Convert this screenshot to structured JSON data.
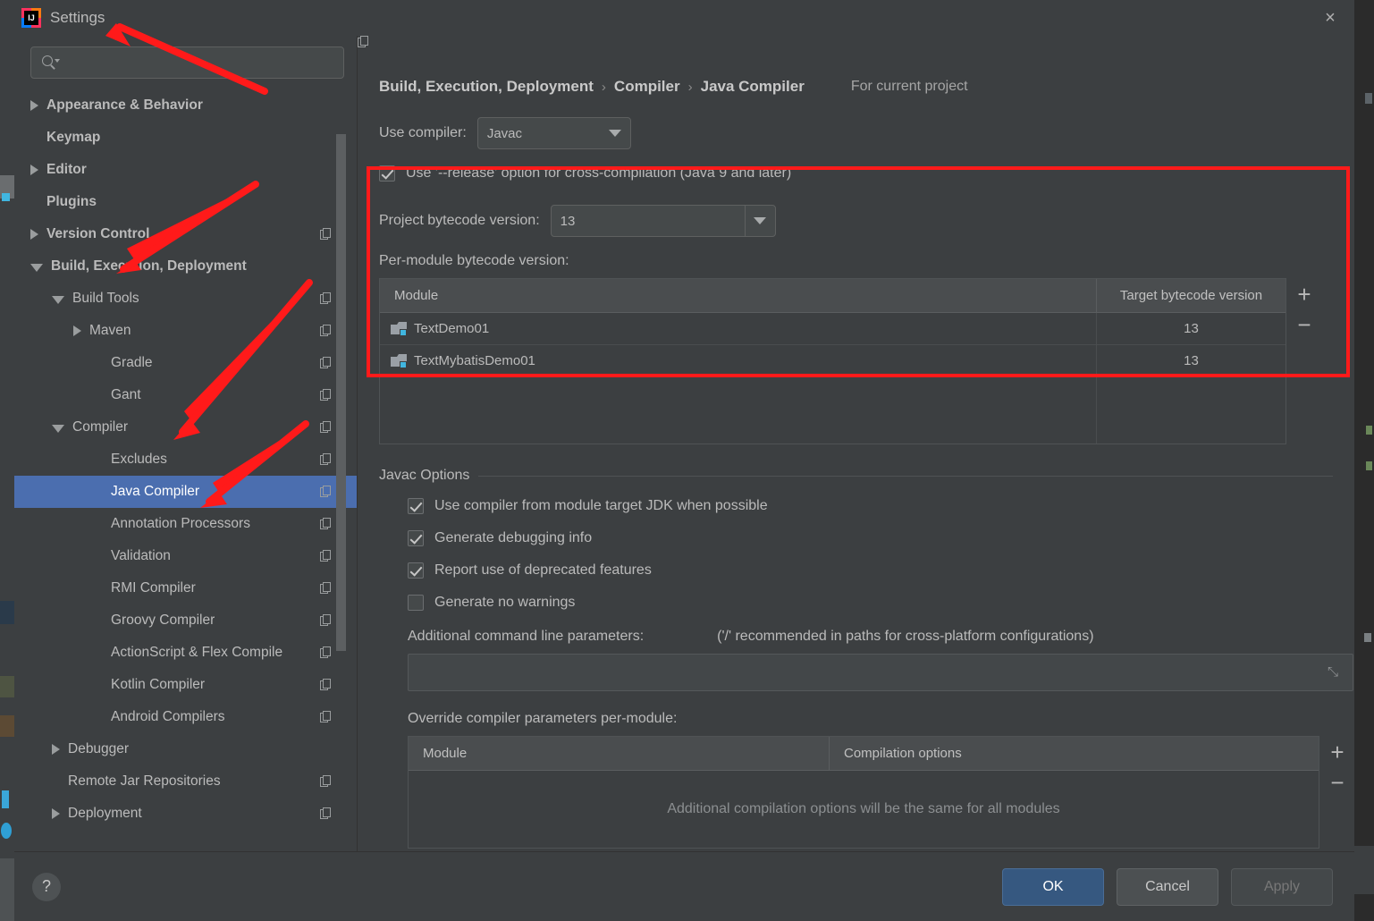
{
  "window": {
    "title": "Settings",
    "logo_text": "IJ",
    "close_label": "×"
  },
  "search": {
    "value": "",
    "placeholder": ""
  },
  "sidebar": {
    "items": [
      {
        "label": "Appearance & Behavior",
        "indent": 0,
        "state": "collapsed",
        "bold": true,
        "copy": false,
        "selected": false
      },
      {
        "label": "Keymap",
        "indent": 0,
        "state": "leaf",
        "bold": true,
        "copy": false,
        "selected": false
      },
      {
        "label": "Editor",
        "indent": 0,
        "state": "collapsed",
        "bold": true,
        "copy": false,
        "selected": false
      },
      {
        "label": "Plugins",
        "indent": 0,
        "state": "leaf",
        "bold": true,
        "copy": false,
        "selected": false
      },
      {
        "label": "Version Control",
        "indent": 0,
        "state": "collapsed",
        "bold": true,
        "copy": true,
        "selected": false
      },
      {
        "label": "Build, Execution, Deployment",
        "indent": 0,
        "state": "expanded",
        "bold": true,
        "copy": false,
        "selected": false
      },
      {
        "label": "Build Tools",
        "indent": 1,
        "state": "expanded",
        "bold": false,
        "copy": true,
        "selected": false
      },
      {
        "label": "Maven",
        "indent": 2,
        "state": "collapsed",
        "bold": false,
        "copy": true,
        "selected": false
      },
      {
        "label": "Gradle",
        "indent": 3,
        "state": "leaf",
        "bold": false,
        "copy": true,
        "selected": false
      },
      {
        "label": "Gant",
        "indent": 3,
        "state": "leaf",
        "bold": false,
        "copy": true,
        "selected": false
      },
      {
        "label": "Compiler",
        "indent": 1,
        "state": "expanded",
        "bold": false,
        "copy": true,
        "selected": false
      },
      {
        "label": "Excludes",
        "indent": 3,
        "state": "leaf",
        "bold": false,
        "copy": true,
        "selected": false
      },
      {
        "label": "Java Compiler",
        "indent": 3,
        "state": "leaf",
        "bold": false,
        "copy": true,
        "selected": true
      },
      {
        "label": "Annotation Processors",
        "indent": 3,
        "state": "leaf",
        "bold": false,
        "copy": true,
        "selected": false
      },
      {
        "label": "Validation",
        "indent": 3,
        "state": "leaf",
        "bold": false,
        "copy": true,
        "selected": false
      },
      {
        "label": "RMI Compiler",
        "indent": 3,
        "state": "leaf",
        "bold": false,
        "copy": true,
        "selected": false
      },
      {
        "label": "Groovy Compiler",
        "indent": 3,
        "state": "leaf",
        "bold": false,
        "copy": true,
        "selected": false
      },
      {
        "label": "ActionScript & Flex Compile",
        "indent": 3,
        "state": "leaf",
        "bold": false,
        "copy": true,
        "selected": false
      },
      {
        "label": "Kotlin Compiler",
        "indent": 3,
        "state": "leaf",
        "bold": false,
        "copy": true,
        "selected": false
      },
      {
        "label": "Android Compilers",
        "indent": 3,
        "state": "leaf",
        "bold": false,
        "copy": true,
        "selected": false
      },
      {
        "label": "Debugger",
        "indent": 1,
        "state": "collapsed",
        "bold": false,
        "copy": false,
        "selected": false
      },
      {
        "label": "Remote Jar Repositories",
        "indent": 1,
        "state": "leaf",
        "bold": false,
        "copy": true,
        "selected": false
      },
      {
        "label": "Deployment",
        "indent": 1,
        "state": "collapsed",
        "bold": false,
        "copy": true,
        "selected": false
      }
    ]
  },
  "breadcrumb": {
    "parts": [
      "Build, Execution, Deployment",
      "Compiler",
      "Java Compiler"
    ],
    "separator": "›",
    "scope_label": "For current project"
  },
  "compiler": {
    "use_compiler_label": "Use compiler:",
    "use_compiler_value": "Javac",
    "release_option_label": "Use '--release' option for cross-compilation (Java 9 and later)",
    "release_option_checked": true
  },
  "bytecode": {
    "project_label": "Project bytecode version:",
    "project_value": "13",
    "per_module_label": "Per-module bytecode version:",
    "columns": [
      "Module",
      "Target bytecode version"
    ],
    "rows": [
      {
        "module": "TextDemo01",
        "version": "13"
      },
      {
        "module": "TextMybatisDemo01",
        "version": "13"
      }
    ],
    "add_label": "+",
    "remove_label": "−"
  },
  "javac_options": {
    "group_label": "Javac Options",
    "checkboxes": [
      {
        "label": "Use compiler from module target JDK when possible",
        "checked": true
      },
      {
        "label": "Generate debugging info",
        "checked": true
      },
      {
        "label": "Report use of deprecated features",
        "checked": true
      },
      {
        "label": "Generate no warnings",
        "checked": false
      }
    ],
    "additional_params_label": "Additional command line parameters:",
    "additional_params_hint": "('/' recommended in paths for cross-platform configurations)",
    "additional_params_value": "",
    "expand_icon": "⤡"
  },
  "override": {
    "label": "Override compiler parameters per-module:",
    "columns": [
      "Module",
      "Compilation options"
    ],
    "empty_message": "Additional compilation options will be the same for all modules",
    "add_label": "+",
    "remove_label": "−"
  },
  "footer": {
    "help_label": "?",
    "ok_label": "OK",
    "cancel_label": "Cancel",
    "apply_label": "Apply"
  },
  "colors": {
    "accent_selection": "#4b6eaf",
    "primary_button": "#365880",
    "annotation_red": "#ff1a1a",
    "dialog_bg": "#3c3f41",
    "module_badge": "#40b6e0"
  }
}
